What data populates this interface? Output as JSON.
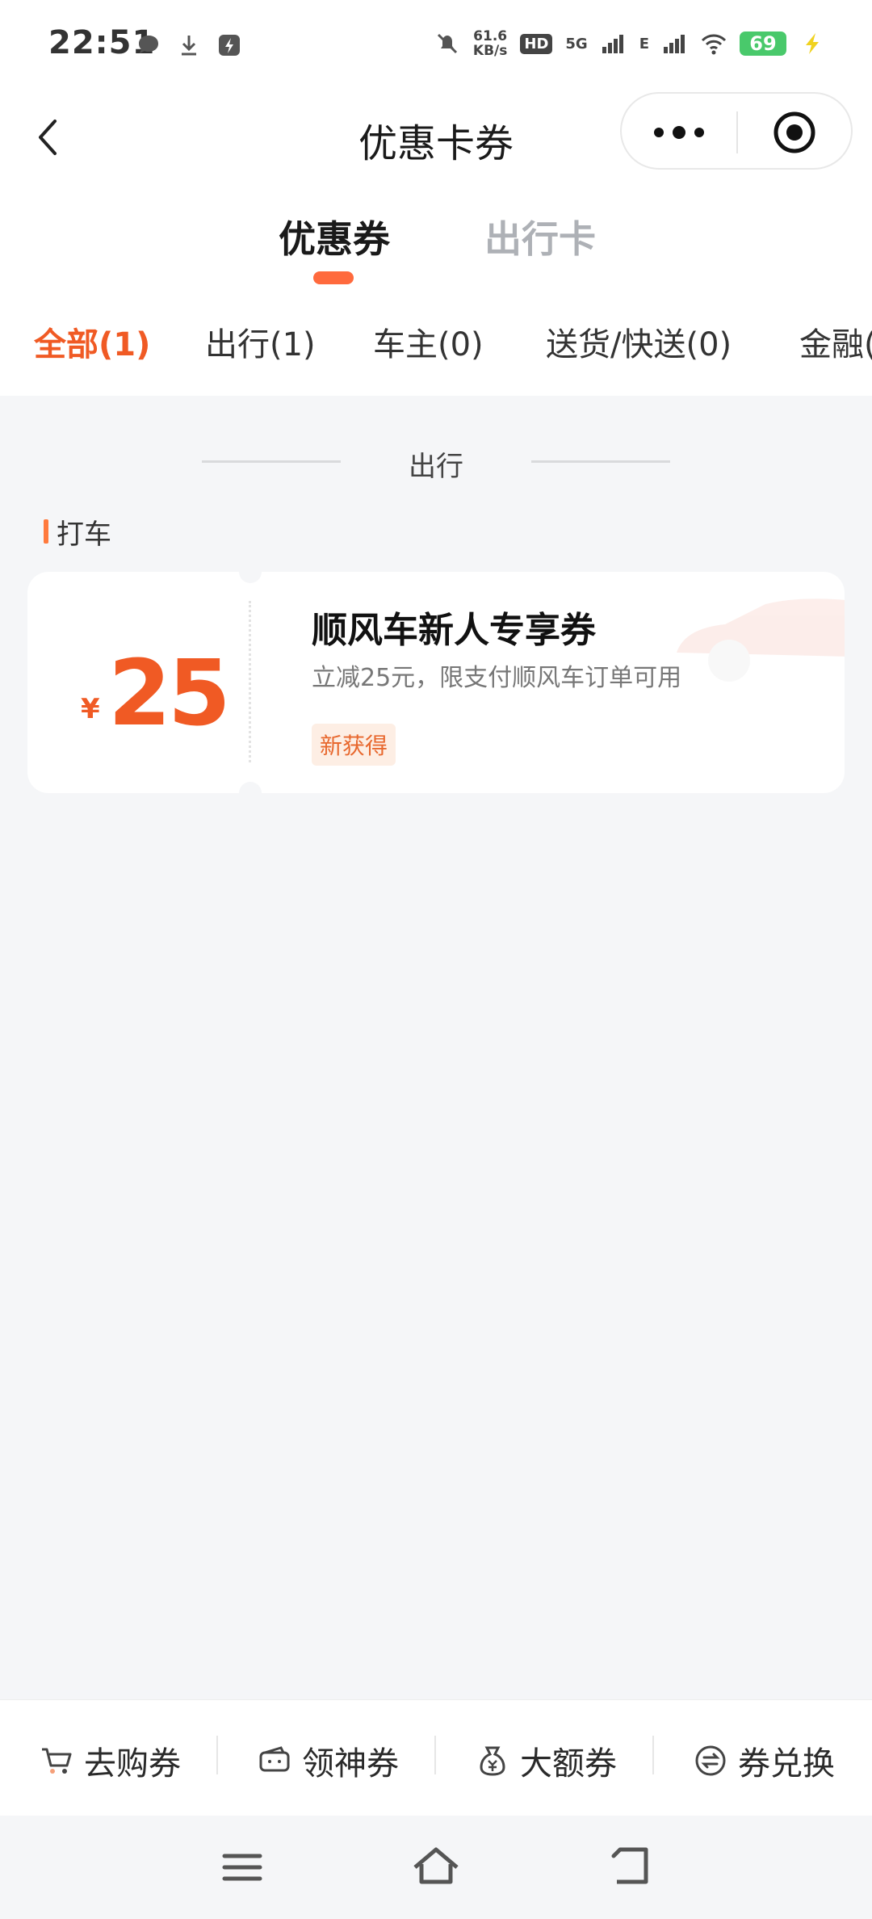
{
  "status_bar": {
    "time": "22:51",
    "speed_value": "61.6",
    "speed_unit": "KB/s",
    "hd_label": "HD",
    "network_1": "5G",
    "network_2": "E",
    "battery": "69"
  },
  "title_bar": {
    "title": "优惠卡券"
  },
  "main_tabs": [
    {
      "label": "优惠券",
      "active": true
    },
    {
      "label": "出行卡",
      "active": false
    }
  ],
  "category_tabs": [
    {
      "label": "全部(1)",
      "active": true
    },
    {
      "label": "出行(1)",
      "active": false
    },
    {
      "label": "车主(0)",
      "active": false
    },
    {
      "label": "送货/快送(0)",
      "active": false
    },
    {
      "label": "金融(",
      "active": false
    }
  ],
  "section": {
    "title": "出行",
    "subsection": "打车"
  },
  "coupon": {
    "currency_symbol": "¥",
    "amount": "25",
    "name": "顺风车新人专享券",
    "description": "立减25元，限支付顺风车订单可用",
    "tag": "新获得"
  },
  "bottom_actions": [
    {
      "label": "去购券",
      "icon": "cart-icon"
    },
    {
      "label": "领神券",
      "icon": "ticket-icon"
    },
    {
      "label": "大额券",
      "icon": "money-bag-icon"
    },
    {
      "label": "券兑换",
      "icon": "exchange-icon"
    }
  ],
  "colors": {
    "accent": "#f05a24",
    "indicator": "#ff6a3d",
    "background": "#f5f6f8",
    "tag_bg": "#fdeee4"
  }
}
